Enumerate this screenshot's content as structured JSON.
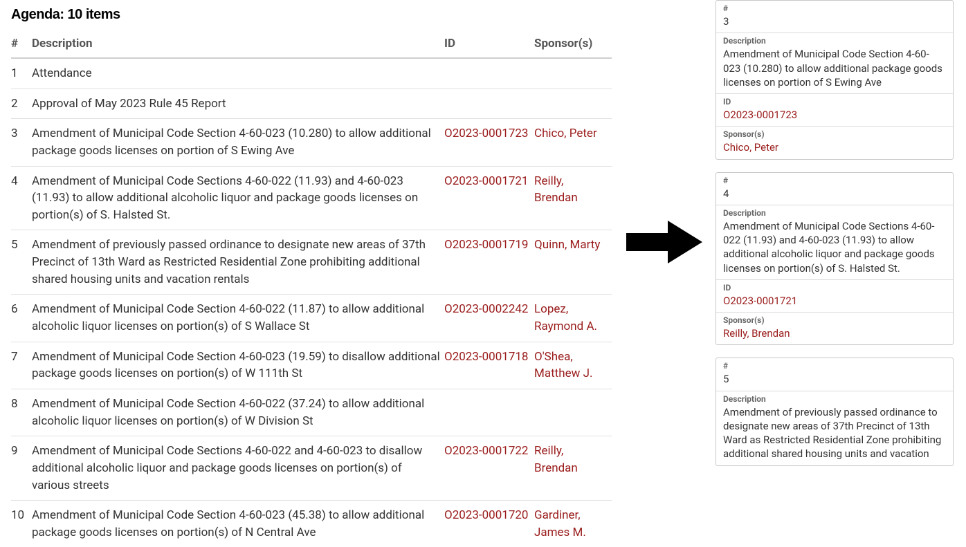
{
  "title": "Agenda: 10 items",
  "headers": {
    "num": "#",
    "description": "Description",
    "id": "ID",
    "sponsor": "Sponsor(s)"
  },
  "items": [
    {
      "num": "1",
      "description": "Attendance",
      "id": "",
      "sponsor": ""
    },
    {
      "num": "2",
      "description": "Approval of May 2023 Rule 45 Report",
      "id": "",
      "sponsor": ""
    },
    {
      "num": "3",
      "description": "Amendment of Municipal Code Section 4-60-023 (10.280) to allow additional package goods licenses on portion of S Ewing Ave",
      "id": "O2023-0001723",
      "sponsor": "Chico, Peter"
    },
    {
      "num": "4",
      "description": "Amendment of Municipal Code Sections 4-60-022 (11.93) and 4-60-023 (11.93) to allow additional alcoholic liquor and package goods licenses on portion(s) of S. Halsted St.",
      "id": "O2023-0001721",
      "sponsor": "Reilly, Brendan"
    },
    {
      "num": "5",
      "description": "Amendment of previously passed ordinance to designate new areas of 37th Precinct of 13th Ward as Restricted Residential Zone prohibiting additional shared housing units and vacation rentals",
      "id": "O2023-0001719",
      "sponsor": "Quinn, Marty"
    },
    {
      "num": "6",
      "description": "Amendment of Municipal Code Section 4-60-022 (11.87) to allow additional alcoholic liquor licenses on portion(s) of S Wallace St",
      "id": "O2023-0002242",
      "sponsor": "Lopez, Raymond A."
    },
    {
      "num": "7",
      "description": "Amendment of Municipal Code Section 4-60-023 (19.59) to disallow additional package goods licenses on portion(s) of W 111th St",
      "id": "O2023-0001718",
      "sponsor": "O'Shea, Matthew J."
    },
    {
      "num": "8",
      "description": "Amendment of Municipal Code Section 4-60-022 (37.24) to allow additional alcoholic liquor licenses on portion(s) of W Division St",
      "id": "",
      "sponsor": ""
    },
    {
      "num": "9",
      "description": "Amendment of Municipal Code Sections 4-60-022 and 4-60-023 to disallow additional alcoholic liquor and package goods licenses on portion(s) of various streets",
      "id": "O2023-0001722",
      "sponsor": "Reilly, Brendan"
    },
    {
      "num": "10",
      "description": "Amendment of Municipal Code Section 4-60-023 (45.38) to allow additional package goods licenses on portion(s) of N Central Ave",
      "id": "O2023-0001720",
      "sponsor": "Gardiner, James M."
    }
  ],
  "cardLabels": {
    "num": "#",
    "description": "Description",
    "id": "ID",
    "sponsor": "Sponsor(s)"
  },
  "cards": [
    {
      "num": "3",
      "description": "Amendment of Municipal Code Section 4-60-023 (10.280) to allow additional package goods licenses on portion of S Ewing Ave",
      "id": "O2023-0001723",
      "sponsor": "Chico, Peter"
    },
    {
      "num": "4",
      "description": "Amendment of Municipal Code Sections 4-60-022 (11.93) and 4-60-023 (11.93) to allow additional alcoholic liquor and package goods licenses on portion(s) of S. Halsted St.",
      "id": "O2023-0001721",
      "sponsor": "Reilly, Brendan"
    },
    {
      "num": "5",
      "description": "Amendment of previously passed ordinance to designate new areas of 37th Precinct of 13th Ward as Restricted Residential Zone prohibiting additional shared housing units and vacation",
      "id": "",
      "sponsor": ""
    }
  ]
}
